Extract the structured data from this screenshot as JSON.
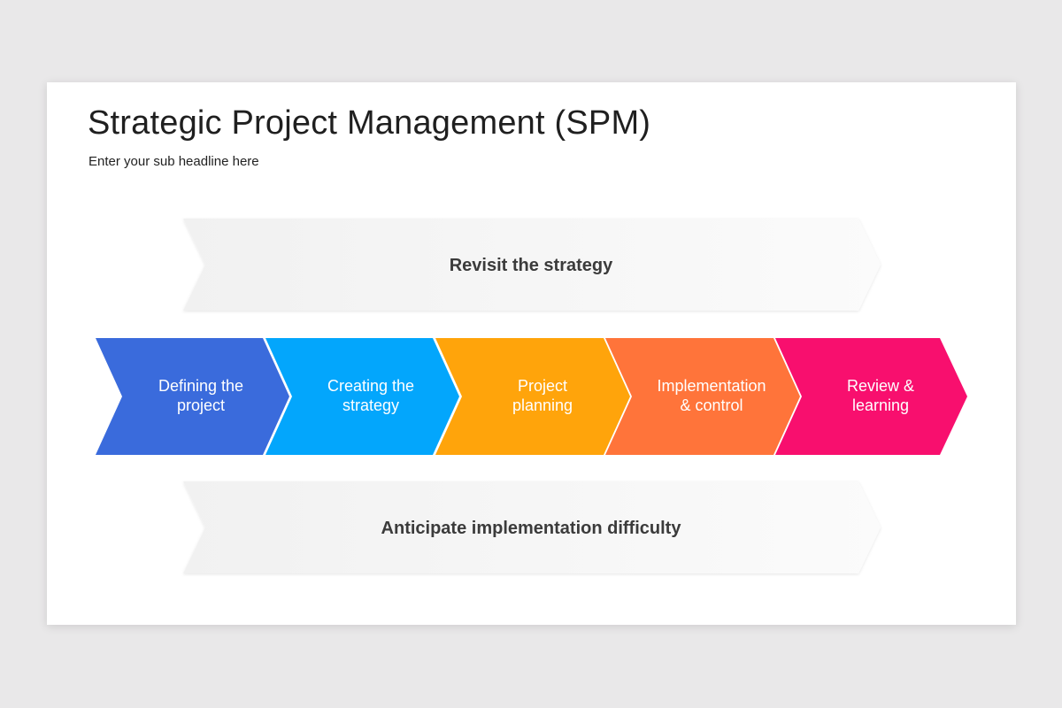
{
  "header": {
    "title": "Strategic Project Management (SPM)",
    "subtitle": "Enter your sub headline here"
  },
  "bands": {
    "top": {
      "label": "Revisit the strategy"
    },
    "bottom": {
      "label": "Anticipate implementation difficulty"
    }
  },
  "steps": [
    {
      "line1": "Defining the",
      "line2": "project",
      "color": "#3a6bdc"
    },
    {
      "line1": "Creating the",
      "line2": "strategy",
      "color": "#03a6fc"
    },
    {
      "line1": "Project",
      "line2": "planning",
      "color": "#ffa40b"
    },
    {
      "line1": "Implementation",
      "line2": "& control",
      "color": "#ff743a"
    },
    {
      "line1": "Review &",
      "line2": "learning",
      "color": "#f80f6e"
    }
  ]
}
